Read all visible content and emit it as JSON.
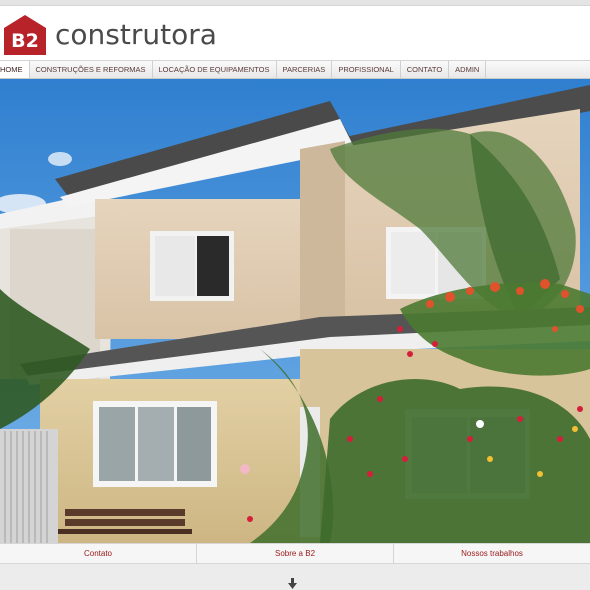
{
  "brand": {
    "badge_text": "B2",
    "name": "construtora",
    "badge_color": "#b8232a"
  },
  "nav": {
    "items": [
      {
        "label": "HOME",
        "active": true
      },
      {
        "label": "CONSTRUÇÕES E REFORMAS",
        "active": false
      },
      {
        "label": "LOCAÇÃO DE EQUIPAMENTOS",
        "active": false
      },
      {
        "label": "PARCERIAS",
        "active": false
      },
      {
        "label": "PROFISSIONAL",
        "active": false
      },
      {
        "label": "CONTATO",
        "active": false
      },
      {
        "label": "ADMIN",
        "active": false
      }
    ]
  },
  "hero": {
    "icon": "house-photo"
  },
  "footer": {
    "links": [
      {
        "label": "Contato"
      },
      {
        "label": "Sobre a B2"
      },
      {
        "label": "Nossos trabalhos"
      }
    ],
    "link_color": "#9a1818"
  },
  "scroll_hint": {
    "icon": "arrow-down-icon"
  }
}
